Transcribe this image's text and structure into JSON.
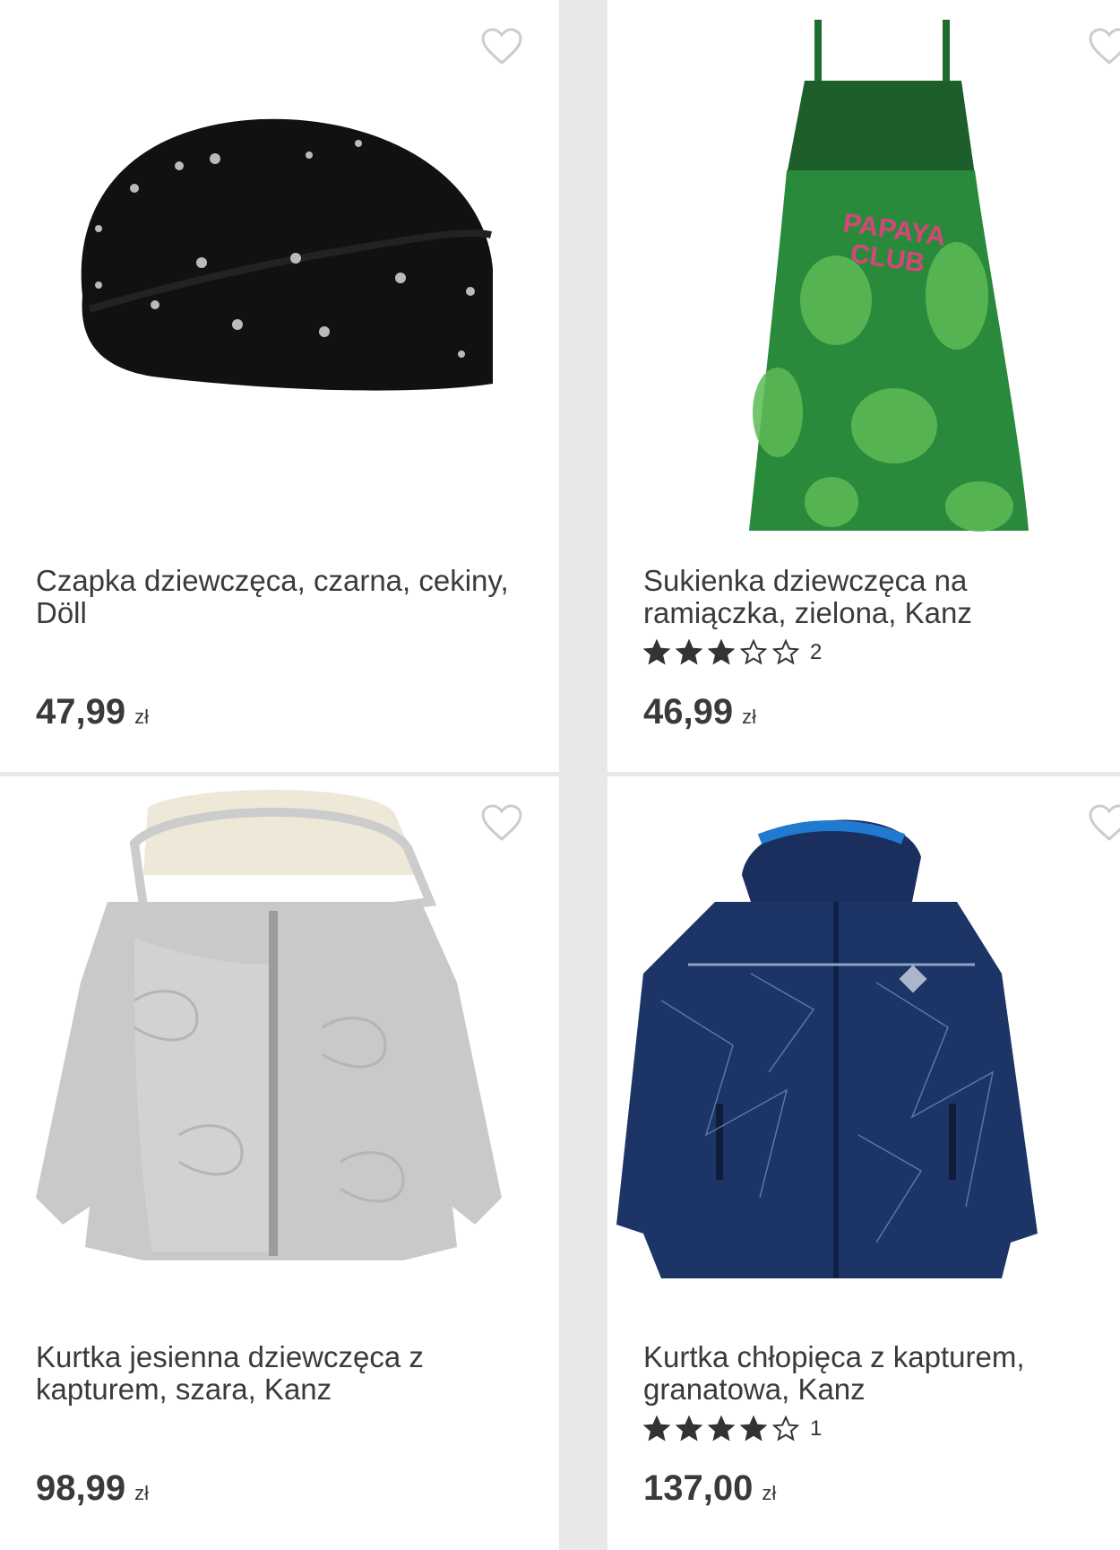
{
  "currency": "zł",
  "products": [
    {
      "title": "Czapka dziewczęca, czarna, cekiny, Döll",
      "price": "47,99",
      "rating": null,
      "review_count": null,
      "image_icon": "beanie-hat-image"
    },
    {
      "title": "Sukienka dziewczęca na ramiączka, zielona, Kanz",
      "price": "46,99",
      "rating": 3,
      "review_count": "2",
      "image_icon": "dress-image"
    },
    {
      "title": "Kurtka jesienna dziewczęca z kapturem, szara, Kanz",
      "price": "98,99",
      "rating": null,
      "review_count": null,
      "image_icon": "grey-jacket-image"
    },
    {
      "title": "Kurtka chłopięca z kapturem, granatowa, Kanz",
      "price": "137,00",
      "rating": 4,
      "review_count": "1",
      "image_icon": "navy-jacket-image"
    }
  ],
  "colors": {
    "background": "#e8e8e8",
    "card": "#ffffff",
    "text": "#3a3a3a",
    "heart_outline": "#cccccc",
    "star": "#333333"
  }
}
